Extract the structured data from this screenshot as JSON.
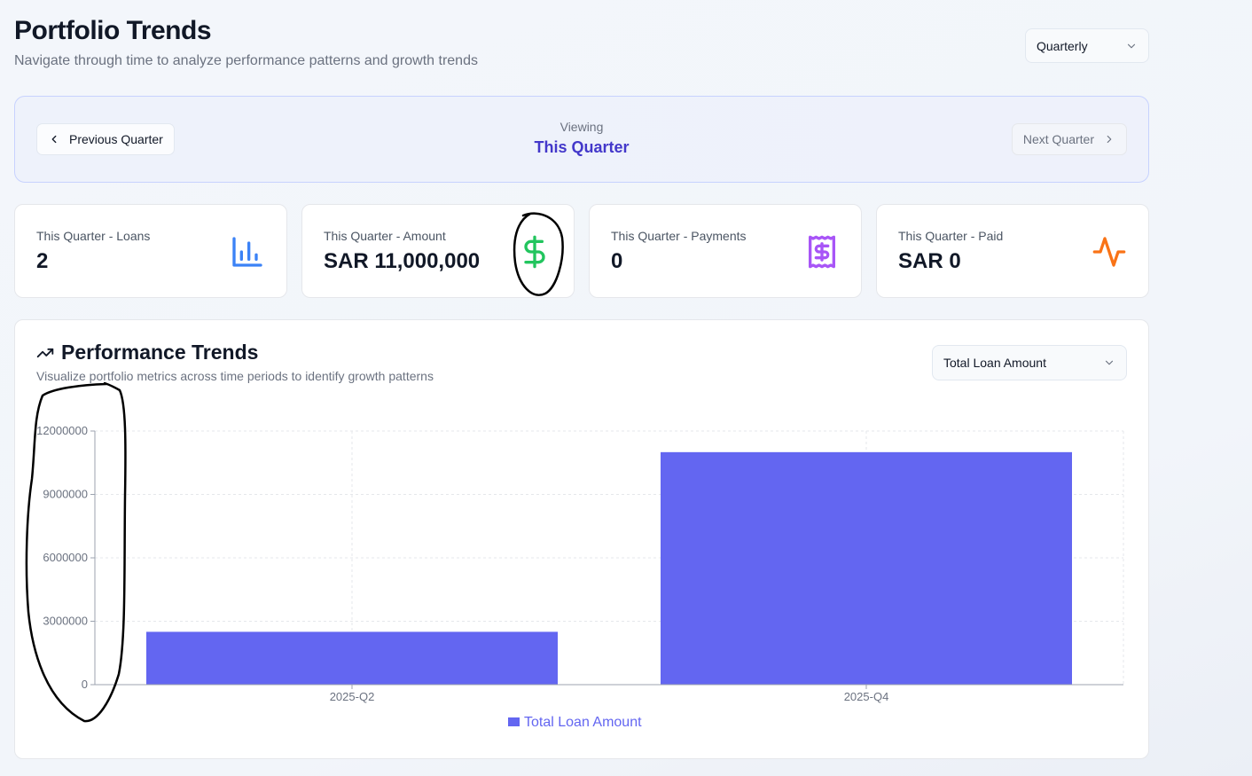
{
  "header": {
    "title": "Portfolio Trends",
    "subtitle": "Navigate through time to analyze performance patterns and growth trends",
    "period_select": "Quarterly"
  },
  "nav": {
    "prev_label": "Previous Quarter",
    "viewing_label": "Viewing",
    "viewing_value": "This Quarter",
    "next_label": "Next Quarter"
  },
  "stats": [
    {
      "label": "This Quarter - Loans",
      "value": "2",
      "icon": "bar-chart-icon",
      "color": "#3b82f6"
    },
    {
      "label": "This Quarter - Amount",
      "value": "SAR 11,000,000",
      "icon": "dollar-icon",
      "color": "#22c55e"
    },
    {
      "label": "This Quarter - Payments",
      "value": "0",
      "icon": "receipt-icon",
      "color": "#a855f7"
    },
    {
      "label": "This Quarter - Paid",
      "value": "SAR 0",
      "icon": "activity-icon",
      "color": "#f97316"
    }
  ],
  "chart_panel": {
    "title": "Performance Trends",
    "subtitle": "Visualize portfolio metrics across time periods to identify growth patterns",
    "metric_select": "Total Loan Amount"
  },
  "chart_data": {
    "type": "bar",
    "categories": [
      "2025-Q2",
      "2025-Q4"
    ],
    "series": [
      {
        "name": "Total Loan Amount",
        "values": [
          2500000,
          11000000
        ],
        "color": "#6366f1"
      }
    ],
    "yticks": [
      "0",
      "3000000",
      "6000000",
      "9000000",
      "12000000"
    ],
    "ylim": [
      0,
      12000000
    ],
    "grid": true,
    "legend": "bottom"
  }
}
